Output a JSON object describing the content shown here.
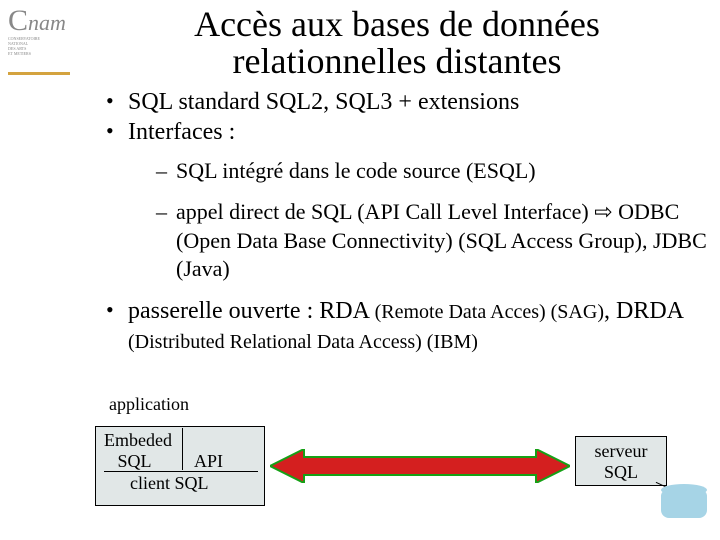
{
  "logo": {
    "word_html": "Cnam",
    "subtitle": "CONSERVATOIRE\nNATIONAL\nDES ARTS\nET METIERS"
  },
  "title_line1": "Accès aux bases de données",
  "title_line2": "relationnelles distantes",
  "bullets": {
    "b1": "SQL standard SQL2, SQL3 + extensions",
    "b2": "Interfaces :",
    "sub1": "SQL intégré dans le code source (ESQL)",
    "sub2": "appel direct de SQL (API Call Level Interface) ⇨ ODBC (Open Data Base Connectivity) (SQL Access Group), JDBC (Java)",
    "b3_main": "passerelle ouverte : RDA ",
    "b3_small1": "(Remote Data Acces) (SAG)",
    "b3_mid": ", DRDA ",
    "b3_small2": "(Distributed Relational Data Access) (IBM)"
  },
  "diagram": {
    "application": "application",
    "embedded": "Embeded",
    "sql": "SQL",
    "api": "API",
    "client_sql": "client SQL",
    "server_line1": "serveur",
    "server_line2": "SQL"
  }
}
